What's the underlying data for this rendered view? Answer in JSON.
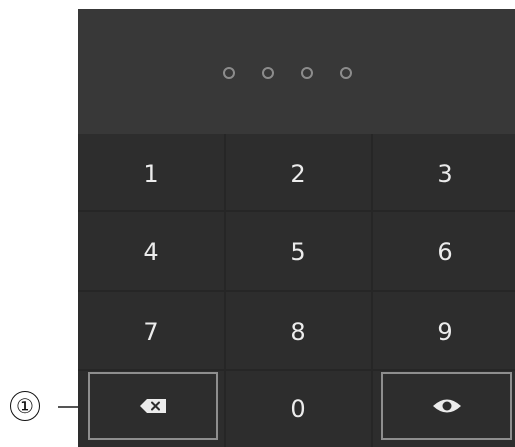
{
  "pin_display": {
    "dots": 4
  },
  "keypad": {
    "keys": [
      "1",
      "2",
      "3",
      "4",
      "5",
      "6",
      "7",
      "8",
      "9"
    ],
    "zero": "0",
    "backspace_icon": "backspace-icon",
    "reveal_icon": "eye-icon"
  },
  "callout": {
    "label": "①"
  },
  "colors": {
    "panel": "#2d2d2d",
    "display": "#383838",
    "text": "#ececec",
    "outline": "#8e8e8e"
  }
}
